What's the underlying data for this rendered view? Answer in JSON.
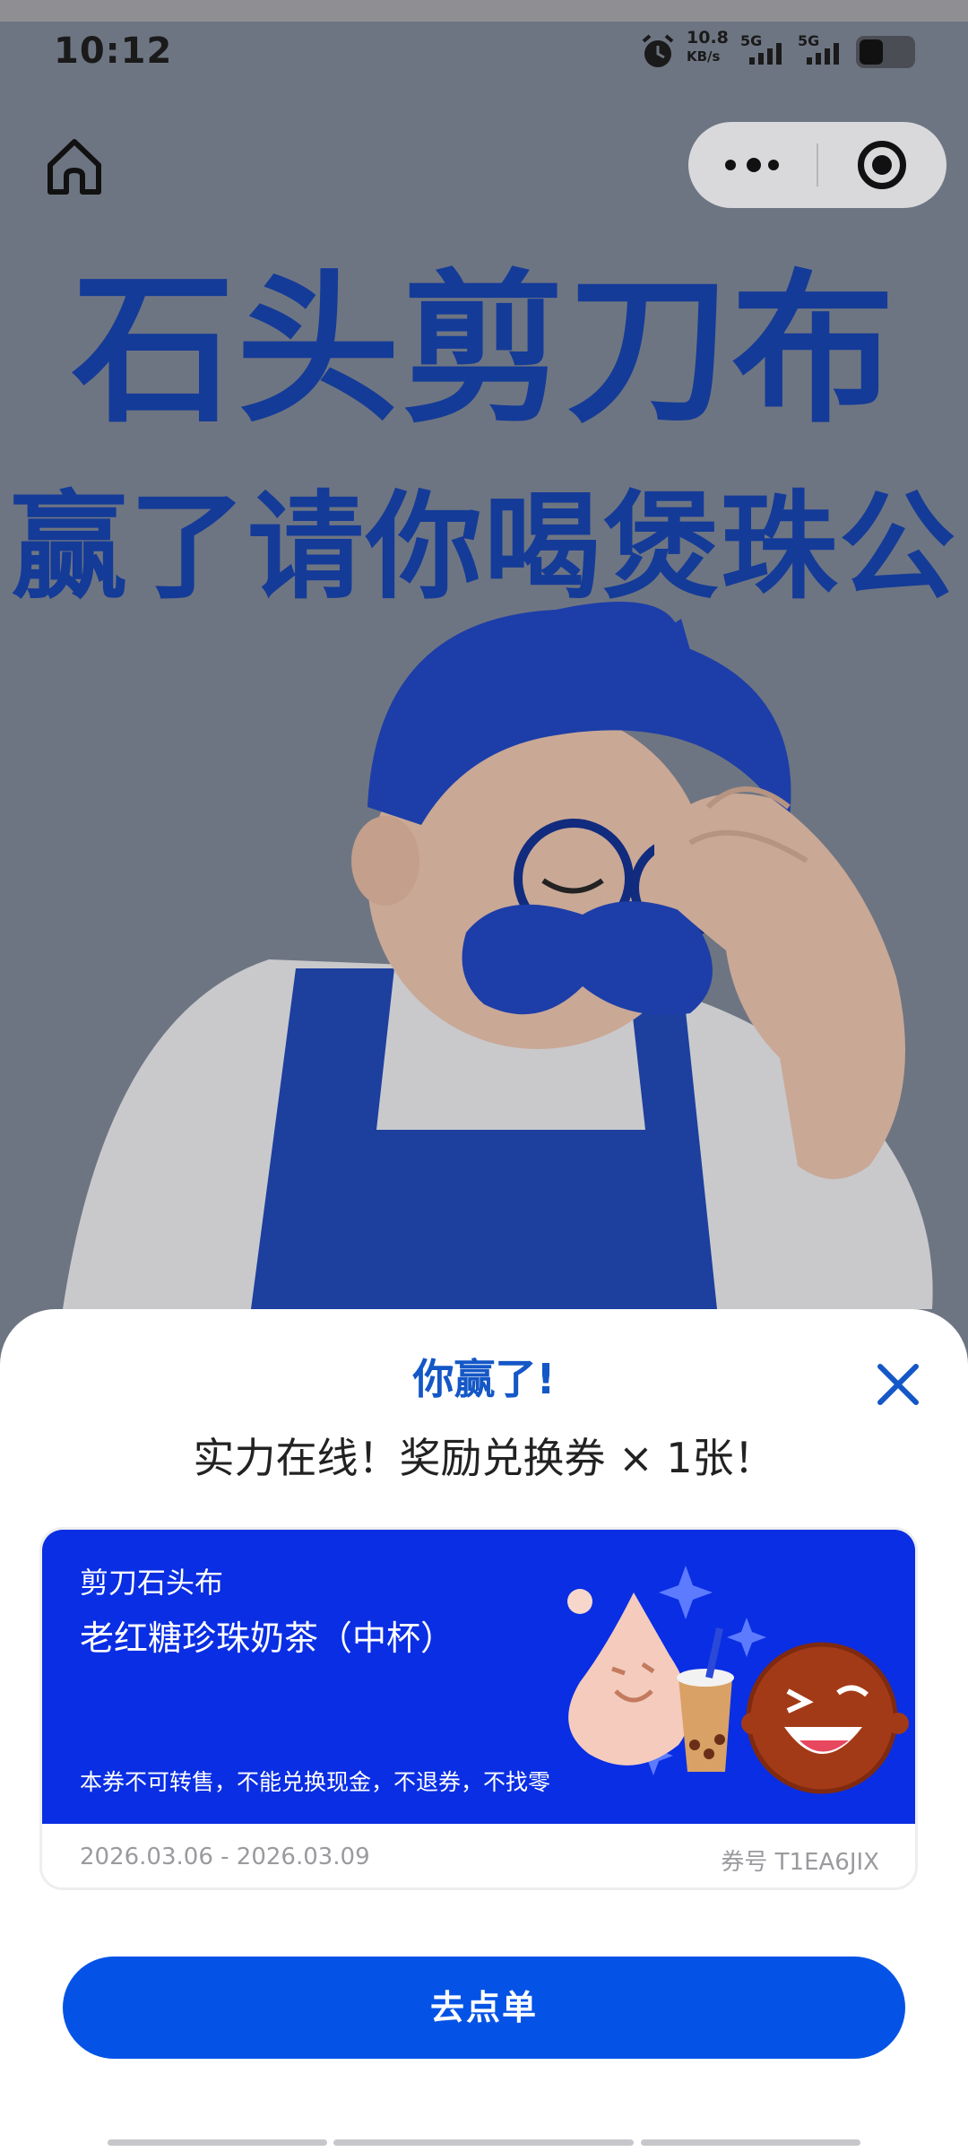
{
  "status_bar": {
    "time": "10:12",
    "net_speed_value": "10.8",
    "net_speed_unit": "KB/s",
    "signal1_label": "5G",
    "signal2_label": "5G",
    "icons": [
      "alarm-icon",
      "signal-icon",
      "signal-icon",
      "battery-icon"
    ]
  },
  "nav": {
    "home_icon": "home-icon",
    "more_icon": "more-dots-icon",
    "target_icon": "close-miniprogram-icon"
  },
  "hero": {
    "line1": "石头剪刀布",
    "line2": "赢了请你喝煲珠公"
  },
  "sheet": {
    "title": "你赢了!",
    "subtitle": "实力在线！奖励兑换券 × 1张！",
    "close_icon": "close-icon",
    "coupon": {
      "brand": "剪刀石头布",
      "name": "老红糖珍珠奶茶（中杯）",
      "terms": "本券不可转售，不能兑换现金，不退券，不找零",
      "valid_dates": "2026.03.06 - 2026.03.09",
      "code": "券号 T1EA6JIX"
    },
    "order_button": "去点单"
  },
  "colors": {
    "accent": "#0553e6",
    "hero_text": "#143b98",
    "coupon_bg": "#0a2ee3",
    "overlay": "#6e7582"
  }
}
